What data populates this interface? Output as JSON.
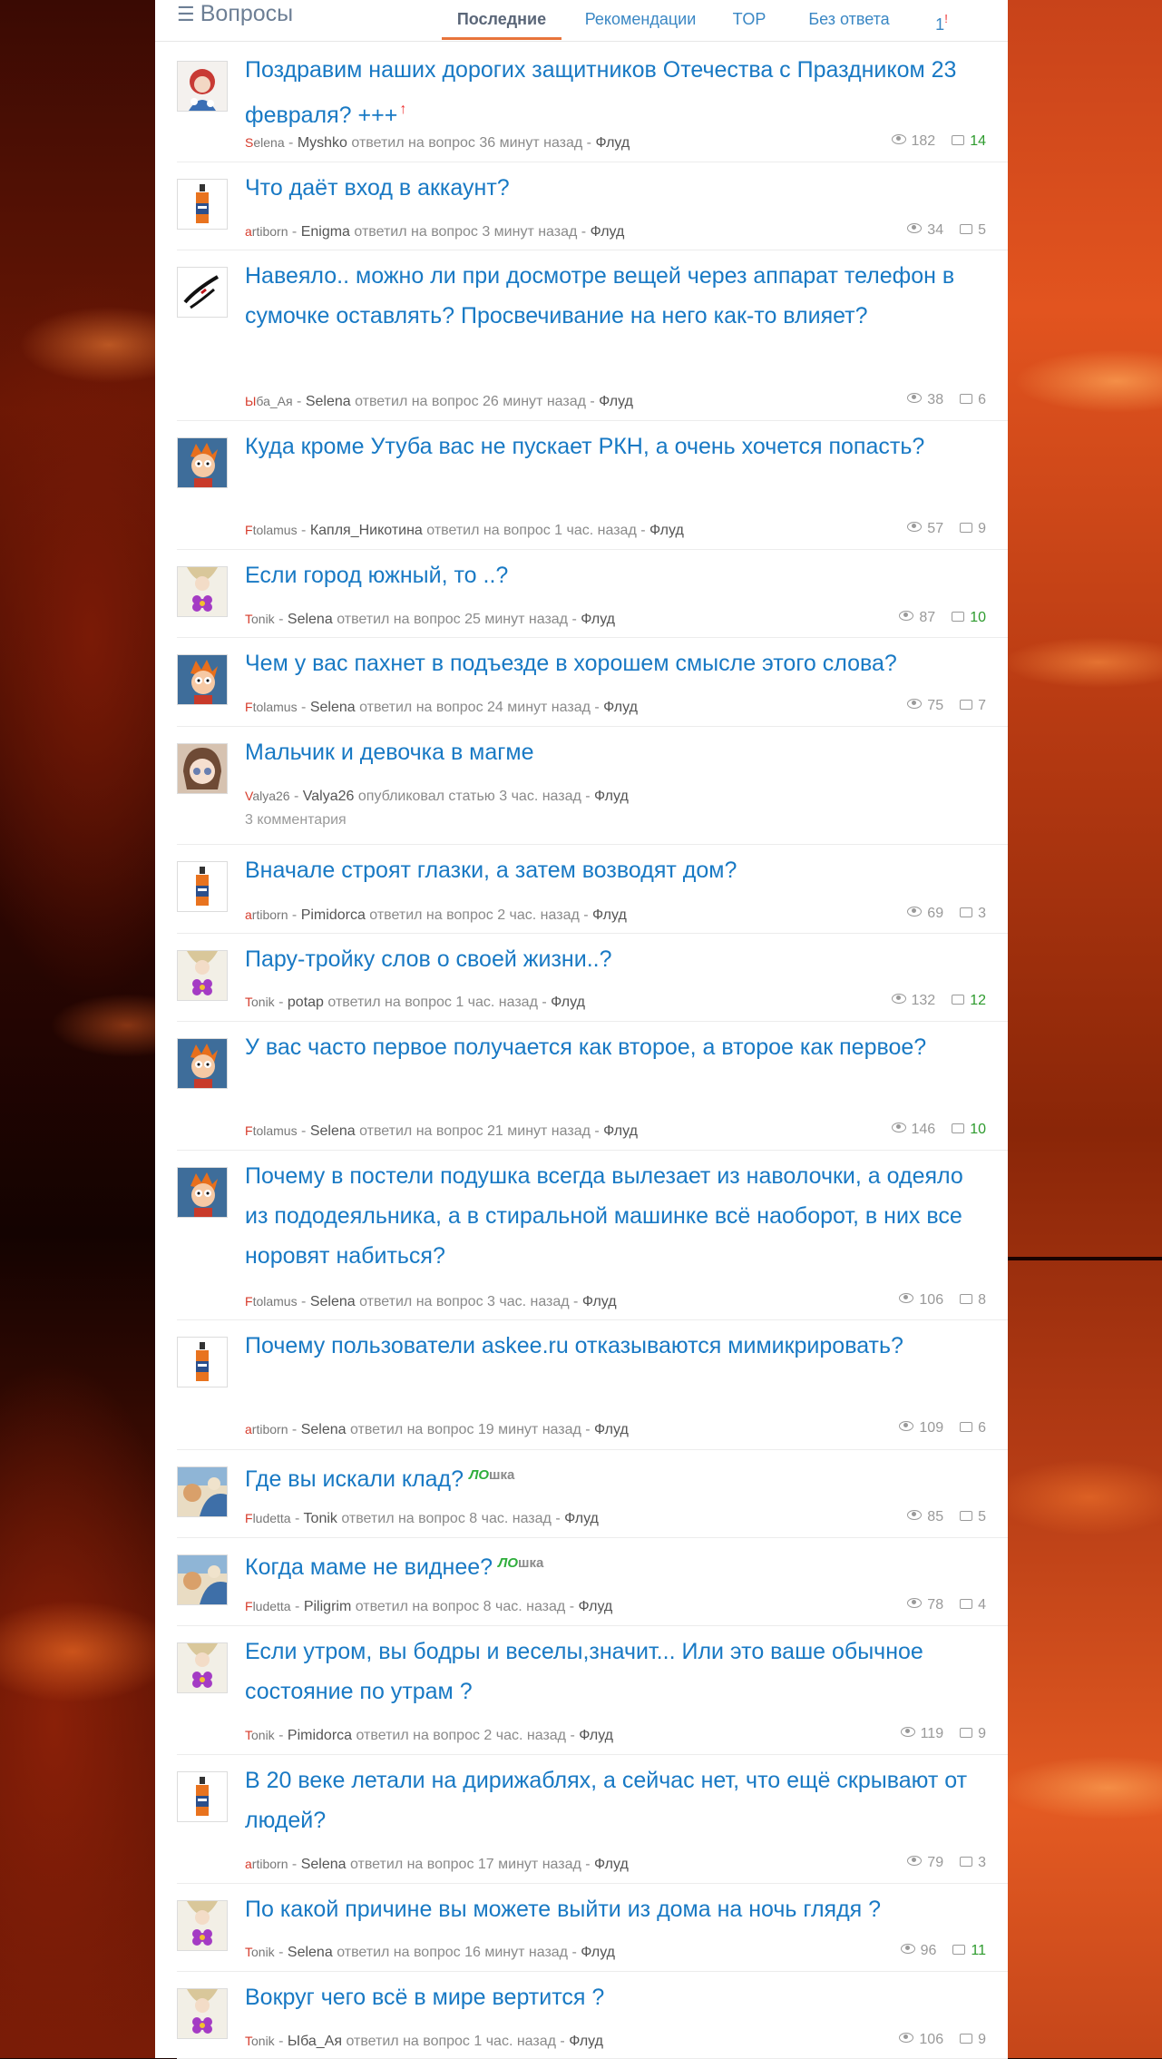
{
  "header": {
    "section_title": "Вопросы",
    "tabs": [
      "Последние",
      "Рекомендации",
      "TOP",
      "Без ответа",
      "1"
    ],
    "active_tab": "Последние",
    "tab_mark": "!"
  },
  "questions": [
    {
      "title": "Поздравим наших дорогих защитников Отечества с Праздником 23 февраля? +++",
      "title_mark": "↑",
      "author": "Selena",
      "user": "Myshko",
      "action": "ответил на вопрос 36 минут назад",
      "category": "Флуд",
      "views": "182",
      "comments": "14",
      "hot": true,
      "avatar": "folk-woman"
    },
    {
      "title": "Что даёт вход в аккаунт?",
      "author": "artiborn",
      "user": "Enigma",
      "action": "ответил на вопрос 3 минут назад",
      "category": "Флуд",
      "views": "34",
      "comments": "5",
      "avatar": "bottle"
    },
    {
      "title": "Навеяло.. можно ли при досмотре вещей через аппарат телефон в сумочке оставлять? Просвечивание на него как-то влияет?",
      "author": "Ыба_Ая",
      "user": "Selena",
      "action": "ответил на вопрос 26 минут назад",
      "category": "Флуд",
      "views": "38",
      "comments": "6",
      "avatar": "ink-face"
    },
    {
      "title": "Куда кроме Утуба вас не пускает РКН, а очень хочется попасть?",
      "author": "Ftolamus",
      "user": "Капля_Никотина",
      "action": "ответил на вопрос 1 час. назад",
      "category": "Флуд",
      "views": "57",
      "comments": "9",
      "avatar": "fry"
    },
    {
      "title": "Если город южный, то ..?",
      "author": "Tonik",
      "user": "Selena",
      "action": "ответил на вопрос 25 минут назад",
      "category": "Флуд",
      "views": "87",
      "comments": "10",
      "hot": true,
      "avatar": "flower-girl"
    },
    {
      "title": "Чем у вас пахнет в подъезде в хорошем смысле этого слова?",
      "author": "Ftolamus",
      "user": "Selena",
      "action": "ответил на вопрос 24 минут назад",
      "category": "Флуд",
      "views": "75",
      "comments": "7",
      "avatar": "fry"
    },
    {
      "title": "Мальчик и девочка в магме",
      "author": "Valya26",
      "user": "Valya26",
      "action": "опубликовал статью 3 час. назад",
      "category": "Флуд",
      "sub": "3 комментария",
      "avatar": "anime"
    },
    {
      "title": "Вначале строят глазки, а затем возводят дом?",
      "author": "artiborn",
      "user": "Pimidorca",
      "action": "ответил на вопрос 2 час. назад",
      "category": "Флуд",
      "views": "69",
      "comments": "3",
      "avatar": "bottle"
    },
    {
      "title": "Пару-тройку слов о своей жизни..?",
      "author": "Tonik",
      "user": "potap",
      "action": "ответил на вопрос 1 час. назад",
      "category": "Флуд",
      "views": "132",
      "comments": "12",
      "hot": true,
      "avatar": "flower-girl"
    },
    {
      "title": "У вас часто первое получается как вторoе, а второе как первое?",
      "author": "Ftolamus",
      "user": "Selena",
      "action": "ответил на вопрос 21 минут назад",
      "category": "Флуд",
      "views": "146",
      "comments": "10",
      "hot": true,
      "avatar": "fry"
    },
    {
      "title": "Почему в постели подушка всегда вылезает из наволочки, а одеяло из пододеяльника, а в стиральной машинке всё наоборот, в них все норовят набиться?",
      "author": "Ftolamus",
      "user": "Selena",
      "action": "ответил на вопрос 3 час. назад",
      "category": "Флуд",
      "views": "106",
      "comments": "8",
      "avatar": "fry"
    },
    {
      "title": "Почему пользователи askee.ru отказываются мимикрировать?",
      "author": "artiborn",
      "user": "Selena",
      "action": "ответил на вопрос 19 минут назад",
      "category": "Флуд",
      "views": "109",
      "comments": "6",
      "avatar": "bottle"
    },
    {
      "title": "Где вы искали клад?",
      "lo": true,
      "author": "Fludetta",
      "user": "Tonik",
      "action": "ответил на вопрос 8 час. назад",
      "category": "Флуд",
      "views": "85",
      "comments": "5",
      "avatar": "painting"
    },
    {
      "title": "Когда маме не виднее?",
      "lo": true,
      "author": "Fludetta",
      "user": "Piligrim",
      "action": "ответил на вопрос 8 час. назад",
      "category": "Флуд",
      "views": "78",
      "comments": "4",
      "avatar": "painting"
    },
    {
      "title": "Если утром, вы бодры и веселы,значит... Или это ваше обычное состояние по утрам ?",
      "author": "Tonik",
      "user": "Pimidorca",
      "action": "ответил на вопрос 2 час. назад",
      "category": "Флуд",
      "views": "119",
      "comments": "9",
      "avatar": "flower-girl"
    },
    {
      "title": "В 20 веке летали на дирижаблях, а сейчас нет, что ещё скрывают от людей?",
      "author": "artiborn",
      "user": "Selena",
      "action": "ответил на вопрос 17 минут назад",
      "category": "Флуд",
      "views": "79",
      "comments": "3",
      "avatar": "bottle"
    },
    {
      "title": "По какой причине вы можете выйти из дома на ночь глядя ?",
      "author": "Tonik",
      "user": "Selena",
      "action": "ответил на вопрос 16 минут назад",
      "category": "Флуд",
      "views": "96",
      "comments": "11",
      "hot": true,
      "avatar": "flower-girl"
    },
    {
      "title": "Вокруг чего всё в мире вертится ?",
      "author": "Tonik",
      "user": "Ыба_Ая",
      "action": "ответил на вопрос 1 час. назад",
      "category": "Флуд",
      "views": "106",
      "comments": "9",
      "avatar": "flower-girl"
    }
  ],
  "lo_badge": {
    "green": "ЛО",
    "grey": "шка"
  },
  "colors": {
    "link": "#1879c4",
    "hot": "#2e9b2e",
    "accent": "#e8743b",
    "author_initial": "#d63a2a"
  }
}
